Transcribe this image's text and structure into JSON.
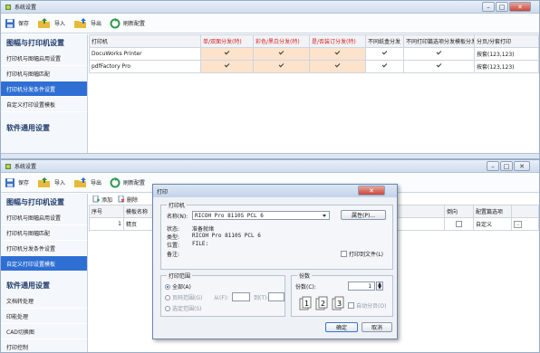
{
  "window1": {
    "title": "系统设置",
    "toolbar": {
      "save": "保存",
      "import": "导入",
      "export": "导出",
      "refresh": "刷新配置"
    },
    "sidebar": {
      "head1": "图幅与打印机设置",
      "items": [
        "打印机与图幅启用设置",
        "打印机与图幅匹配",
        "打印机分发条件设置",
        "自定义打印设置模板"
      ],
      "head2": "软件通用设置"
    },
    "grid": {
      "headers": [
        "打印机",
        "单/双面分发(特)",
        "彩色/黑白分发(特)",
        "是/否装订分发(特)",
        "不同纸盒分发",
        "不同打印篇选项分发模板分发",
        "分页/分套打印"
      ],
      "rows": [
        {
          "name": "DocuWorks Printer",
          "pages": "按套(123,123)"
        },
        {
          "name": "pdfFactory Pro",
          "pages": "按套(123,123)"
        }
      ]
    }
  },
  "window2": {
    "title": "系统设置",
    "toolbar": {
      "save": "保存",
      "import": "导入",
      "export": "导出",
      "refresh": "刷新配置"
    },
    "sidebar": {
      "head1": "图幅与打印机设置",
      "items": [
        "打印机与图幅启用设置",
        "打印机与图幅匹配",
        "打印机分发条件设置",
        "自定义打印设置模板"
      ],
      "head2": "软件通用设置",
      "items2": [
        "文档转处理",
        "印能处理",
        "CAD切换图",
        "打印控制"
      ]
    },
    "grid": {
      "add": "添加",
      "delete": "删除",
      "col_no": "序号",
      "col_name": "模板名称",
      "row_no": "1",
      "row_name": "精页",
      "col_reverse": "倒向",
      "col_config": "配置篇选项",
      "row_config": "自定义",
      "ellipsis": "..."
    }
  },
  "dialog": {
    "title": "打印",
    "printer_group": "打印机",
    "name_label": "名称(N):",
    "name_value": "RICOH Pro 8110S PCL 6",
    "props_button": "属性(P)...",
    "status_label": "状态:",
    "status_value": "准备就绪",
    "type_label": "类型:",
    "type_value": "RICOH Pro 8110S PCL 6",
    "where_label": "位置:",
    "where_value": "FILE:",
    "comment_label": "备注:",
    "print_to_file": "打印到文件(L)",
    "range_group": "打印范围",
    "all": "全部(A)",
    "pages": "页码范围(G)",
    "from": "从(F):",
    "to": "到(T):",
    "selection": "选定范围(S)",
    "copies_group": "份数",
    "copies_label": "份数(C):",
    "copies_value": "1",
    "collate": "自动分页(O)",
    "ok": "确定",
    "cancel": "取消"
  },
  "colors": {
    "accent": "#2f6fd4",
    "orange_cell": "#fde3cc",
    "header_red": "#d62020"
  }
}
